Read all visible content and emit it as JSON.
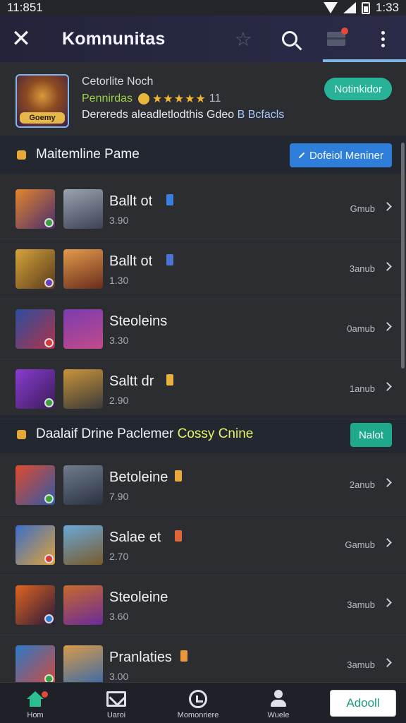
{
  "status_bar": {
    "time": "11:851",
    "clock_right": "1:33"
  },
  "app_bar": {
    "title": "Komnunitas"
  },
  "game": {
    "title": "Cetorlite Noch",
    "thumb_label": "Goemy",
    "rating_label": "Pennirdas",
    "stars": "★★★★★",
    "rating_count": "11",
    "desc_prefix": "Derereds aleadletlodthis Gdeo",
    "desc_highlight": "B Bcfacls",
    "notify_label": "Notinkidor"
  },
  "section1": {
    "title": "Maitemline Pame",
    "button": "Dofeiol Meniner"
  },
  "section2": {
    "title_prefix": "Daalaif Drine Paclemer",
    "title_highlight": "Cossy Cnine",
    "button": "Nalot"
  },
  "items": [
    {
      "name": "Ballt ot",
      "sub": "3.90",
      "meta": "Gmub",
      "tag_color": "#3b7fe0",
      "c1": [
        "#e3862c",
        "#4a2c6e"
      ],
      "c2": [
        "#9aa3b0",
        "#3c4454"
      ],
      "badge": "#3ca03a"
    },
    {
      "name": "Ballt ot",
      "sub": "1.30",
      "meta": "3anub",
      "tag_color": "#4a74d6",
      "c1": [
        "#d6a43a",
        "#5a3a1c"
      ],
      "c2": [
        "#e39b4a",
        "#6a2c1e"
      ],
      "badge": "#6c3db8"
    },
    {
      "name": "Steoleins",
      "sub": "3.30",
      "meta": "0amub",
      "tag_color": "",
      "c1": [
        "#2a4e9e",
        "#b1324a"
      ],
      "c2": [
        "#7a3cb0",
        "#c24a8a"
      ],
      "badge": "#d33a3a"
    },
    {
      "name": "Saltt dr",
      "sub": "2.90",
      "meta": "1anub",
      "tag_color": "#e7b13a",
      "c1": [
        "#8a3cd0",
        "#3a1c5a"
      ],
      "c2": [
        "#c9943a",
        "#3a3a3a"
      ],
      "badge": "#3ca03a"
    },
    {
      "name": "Betoleine",
      "sub": "7.90",
      "meta": "2anub",
      "tag_color": "#e9a83c",
      "c1": [
        "#e04a2c",
        "#2f5aa8"
      ],
      "c2": [
        "#6f7c8c",
        "#2a3242"
      ],
      "badge": "#3ca03a"
    },
    {
      "name": "Salae et",
      "sub": "2.70",
      "meta": "Gamub",
      "tag_color": "#e0663a",
      "c1": [
        "#3a6ec8",
        "#dfa23a"
      ],
      "c2": [
        "#6aa8d8",
        "#7a5a2a"
      ],
      "badge": "#d33a3a"
    },
    {
      "name": "Steoleine",
      "sub": "3.60",
      "meta": "3amub",
      "tag_color": "",
      "c1": [
        "#e0641f",
        "#2a1a3a"
      ],
      "c2": [
        "#c86a2a",
        "#6a2a9a"
      ],
      "badge": "#2f7fda"
    },
    {
      "name": "Pranlaties",
      "sub": "3.00",
      "meta": "3amub",
      "tag_color": "#e9983a",
      "c1": [
        "#2a7ac8",
        "#d04a3a"
      ],
      "c2": [
        "#d89a4a",
        "#3a6aa8"
      ],
      "badge": "#3ca03a"
    }
  ],
  "bottom_nav": {
    "home": "Hom",
    "inbox": "Uaroi",
    "history": "Momonriere",
    "profile": "Wuele",
    "add_button": "Adooll"
  },
  "icons": [
    "close-icon",
    "star-icon",
    "search-icon",
    "mail-icon",
    "more-vert-icon",
    "chevron-right-icon",
    "pencil-icon",
    "home-icon",
    "inbox-icon",
    "clock-icon",
    "user-icon"
  ],
  "colors": {
    "accent_blue": "#2f7fda",
    "accent_green": "#1ea88c",
    "star": "#f3b731"
  }
}
